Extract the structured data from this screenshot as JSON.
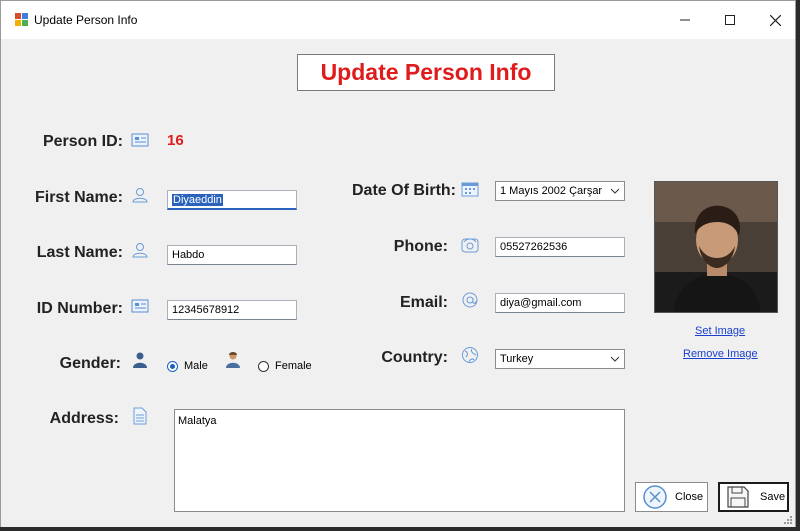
{
  "window": {
    "title": "Update Person Info"
  },
  "form": {
    "heading": "Update Person Info",
    "labels": {
      "person_id": "Person ID:",
      "first_name": "First Name:",
      "last_name": "Last Name:",
      "id_number": "ID Number:",
      "gender": "Gender:",
      "address": "Address:",
      "date_of_birth": "Date Of Birth:",
      "phone": "Phone:",
      "email": "Email:",
      "country": "Country:"
    },
    "values": {
      "person_id": "16",
      "first_name": "Diyaeddin",
      "last_name": "Habdo",
      "id_number": "12345678912",
      "date_of_birth": "1  Mayıs   2002 Çarşar",
      "phone": "05527262536",
      "email": "diya@gmail.com",
      "country": "Turkey",
      "address": "Malatya"
    },
    "gender": {
      "male_label": "Male",
      "female_label": "Female",
      "selected": "Male"
    },
    "image_links": {
      "set": "Set Image",
      "remove": "Remove Image"
    },
    "buttons": {
      "close": "Close",
      "save": "Save"
    }
  },
  "colors": {
    "heading": "#e01b1b",
    "accent": "#2a62bd",
    "link": "#1a3fd0"
  }
}
